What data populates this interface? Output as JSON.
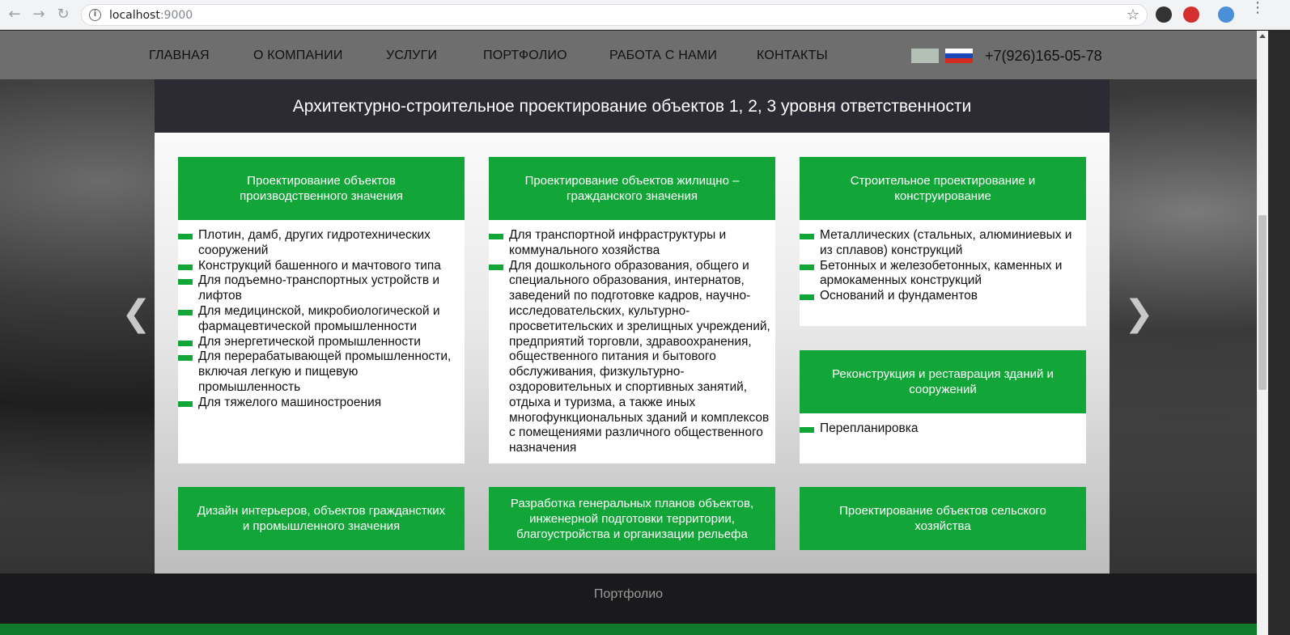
{
  "browser": {
    "url_host": "localhost",
    "url_port": ":9000",
    "back_icon": "arrow-left-icon",
    "forward_icon": "arrow-right-icon",
    "reload_icon": "reload-icon",
    "info_glyph": "i",
    "star_glyph": "☆"
  },
  "nav": {
    "items": [
      "ГЛАВНАЯ",
      "О КОМПАНИИ",
      "УСЛУГИ",
      "ПОРТФОЛИО",
      "РАБОТА С НАМИ",
      "КОНТАКТЫ"
    ],
    "phone": "+7(926)165-05-78"
  },
  "slider": {
    "prev": "❮",
    "next": "❯"
  },
  "panel": {
    "title": "Архитектурно-строительное проектирование объектов 1, 2, 3 уровня ответственности"
  },
  "cards": [
    {
      "title": "Проектирование объектов производственного значения",
      "items": [
        "Плотин, дамб, других гидротехнических сооружений",
        "Конструкций башенного и мачтового типа",
        "Для подъемно-транспортных устройств и лифтов",
        "Для медицинской, микробиологической и фармацевтической промышленности",
        "Для энергетической промышленности",
        "Для перерабатывающей промышленности, включая легкую и пищевую промышленность",
        "Для тяжелого машиностроения"
      ]
    },
    {
      "title": "Проектирование объектов жилищно – гражданского значения",
      "items": [
        "Для транспортной инфраструктуры и коммунального хозяйства",
        "Для дошкольного образования, общего и специального образования, интернатов, заведений по подготовке кадров, научно-исследовательских, культурно-просветительских и зрелищных учреждений, предприятий торговли, здравоохранения, общественного питания и бытового обслуживания, физкультурно-оздоровительных и спортивных занятий, отдыха и туризма, а также иных многофункциональных зданий и комплексов с помещениями различного общественного назначения"
      ]
    },
    {
      "title": "Строительное проектирование и конструирование",
      "items": [
        "Металлических (стальных, алюминиевых и из сплавов) конструкций",
        "Бетонных и железобетонных, каменных и армокаменных конструкций",
        "Оснований и фундаментов"
      ]
    },
    {
      "title": "Реконструкция и реставрация зданий и сооружений",
      "items": [
        "Перепланировка"
      ]
    },
    {
      "title": "Дизайн интерьеров, объектов гражданстких и промышленного значения"
    },
    {
      "title": "Разработка генеральных планов объектов, инженерной подготовки территории, благоустройства и организации рельефа"
    },
    {
      "title": "Проектирование объектов сельского хозяйства"
    }
  ],
  "footer": {
    "label": "Портфолио"
  },
  "colors": {
    "green": "#12a537",
    "header_dark": "#2c2a32",
    "footer_dark": "#1a1a1d"
  }
}
